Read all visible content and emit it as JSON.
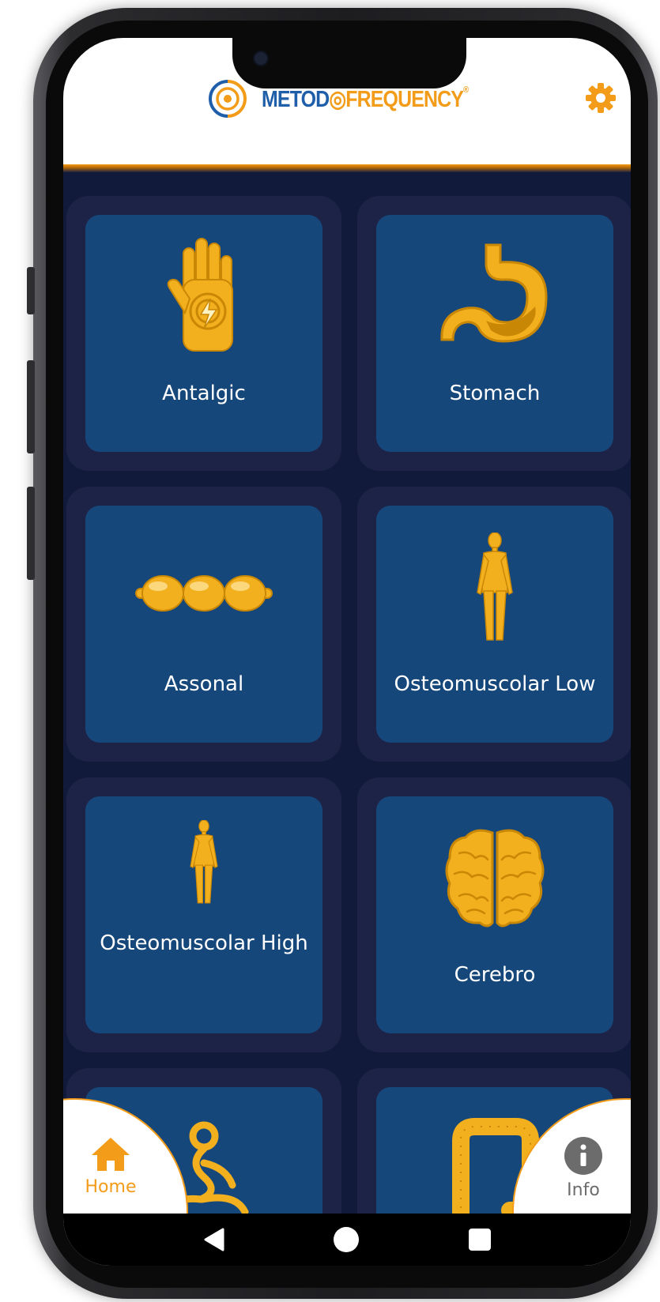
{
  "header": {
    "logo_part1": "METOD",
    "logo_part2": "FREQUENCY",
    "logo_registered": "®"
  },
  "tiles": [
    {
      "label": "Antalgic",
      "icon": "hand-lightning-icon"
    },
    {
      "label": "Stomach",
      "icon": "stomach-icon"
    },
    {
      "label": "Assonal",
      "icon": "axon-beads-icon"
    },
    {
      "label": "Osteomuscolar Low",
      "icon": "human-body-icon"
    },
    {
      "label": "Osteomuscolar High",
      "icon": "human-body-small-icon"
    },
    {
      "label": "Cerebro",
      "icon": "brain-icon"
    },
    {
      "label": "",
      "icon": "meditation-figure-icon"
    },
    {
      "label": "",
      "icon": "intestine-icon"
    }
  ],
  "nav": {
    "home_label": "Home",
    "info_label": "Info"
  },
  "colors": {
    "accent_orange": "#f39c1a",
    "brand_blue": "#1f5ea8",
    "tile_blue": "#16477a",
    "background_navy": "#121a3c"
  }
}
